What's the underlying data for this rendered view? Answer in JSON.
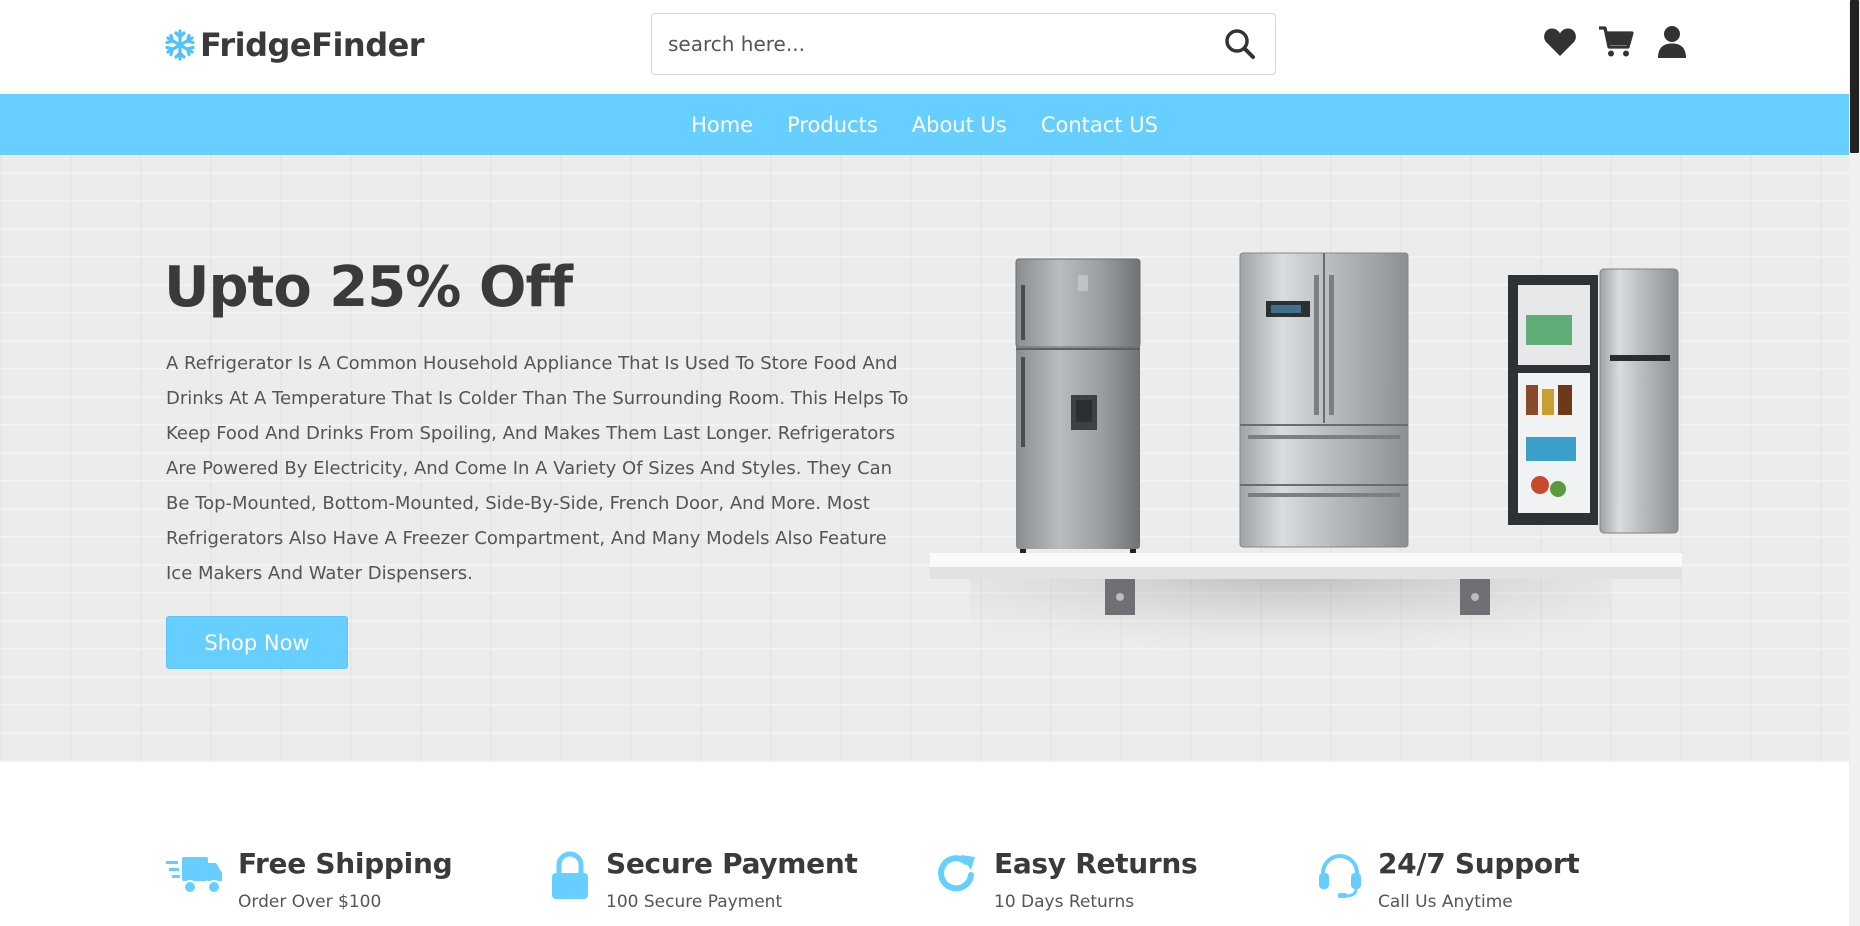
{
  "brand": {
    "name": "FridgeFinder",
    "icon": "snowflake-icon",
    "accent": "#66cfff"
  },
  "search": {
    "placeholder": "search here..."
  },
  "header_icons": [
    "heart-icon",
    "cart-icon",
    "user-icon"
  ],
  "nav": {
    "items": [
      "Home",
      "Products",
      "About Us",
      "Contact US"
    ]
  },
  "hero": {
    "title": "Upto 25% Off",
    "text": "A Refrigerator Is A Common Household Appliance That Is Used To Store Food And Drinks At A Temperature That Is Colder Than The Surrounding Room. This Helps To Keep Food And Drinks From Spoiling, And Makes Them Last Longer. Refrigerators Are Powered By Electricity, And Come In A Variety Of Sizes And Styles. They Can Be Top-Mounted, Bottom-Mounted, Side-By-Side, French Door, And More. Most Refrigerators Also Have A Freezer Compartment, And Many Models Also Feature Ice Makers And Water Dispensers.",
    "button": "Shop Now"
  },
  "features": [
    {
      "icon": "truck-icon",
      "title": "Free Shipping",
      "sub": "Order Over $100"
    },
    {
      "icon": "lock-icon",
      "title": "Secure Payment",
      "sub": "100 Secure Payment"
    },
    {
      "icon": "refresh-icon",
      "title": "Easy Returns",
      "sub": "10 Days Returns"
    },
    {
      "icon": "headset-icon",
      "title": "24/7 Support",
      "sub": "Call Us Anytime"
    }
  ]
}
